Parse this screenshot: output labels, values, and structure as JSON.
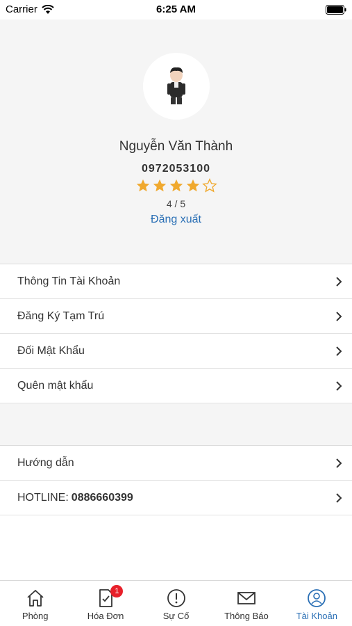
{
  "status_bar": {
    "carrier": "Carrier",
    "time": "6:25 AM"
  },
  "profile": {
    "name": "Nguyễn Văn Thành",
    "phone": "0972053100",
    "rating": 4,
    "rating_max": 5,
    "rating_text": "4 / 5",
    "logout_label": "Đăng xuất"
  },
  "menu_account": [
    {
      "label": "Thông Tin Tài Khoản"
    },
    {
      "label": "Đăng Ký Tạm Trú"
    },
    {
      "label": "Đối Mật Khẩu"
    },
    {
      "label": "Quên mật khẩu"
    }
  ],
  "menu_help": {
    "guide_label": "Hướng dẫn",
    "hotline_label": "HOTLINE:",
    "hotline_number": "0886660399"
  },
  "tabbar": {
    "tabs": [
      {
        "label": "Phòng",
        "icon": "home-icon"
      },
      {
        "label": "Hóa Đơn",
        "icon": "invoice-icon",
        "badge": "1"
      },
      {
        "label": "Sự Cố",
        "icon": "alert-icon"
      },
      {
        "label": "Thông Báo",
        "icon": "mail-icon"
      },
      {
        "label": "Tài Khoản",
        "icon": "user-icon",
        "active": true
      }
    ]
  },
  "colors": {
    "accent": "#2a6fb5",
    "star": "#f0a92e",
    "badge": "#e8202a"
  }
}
